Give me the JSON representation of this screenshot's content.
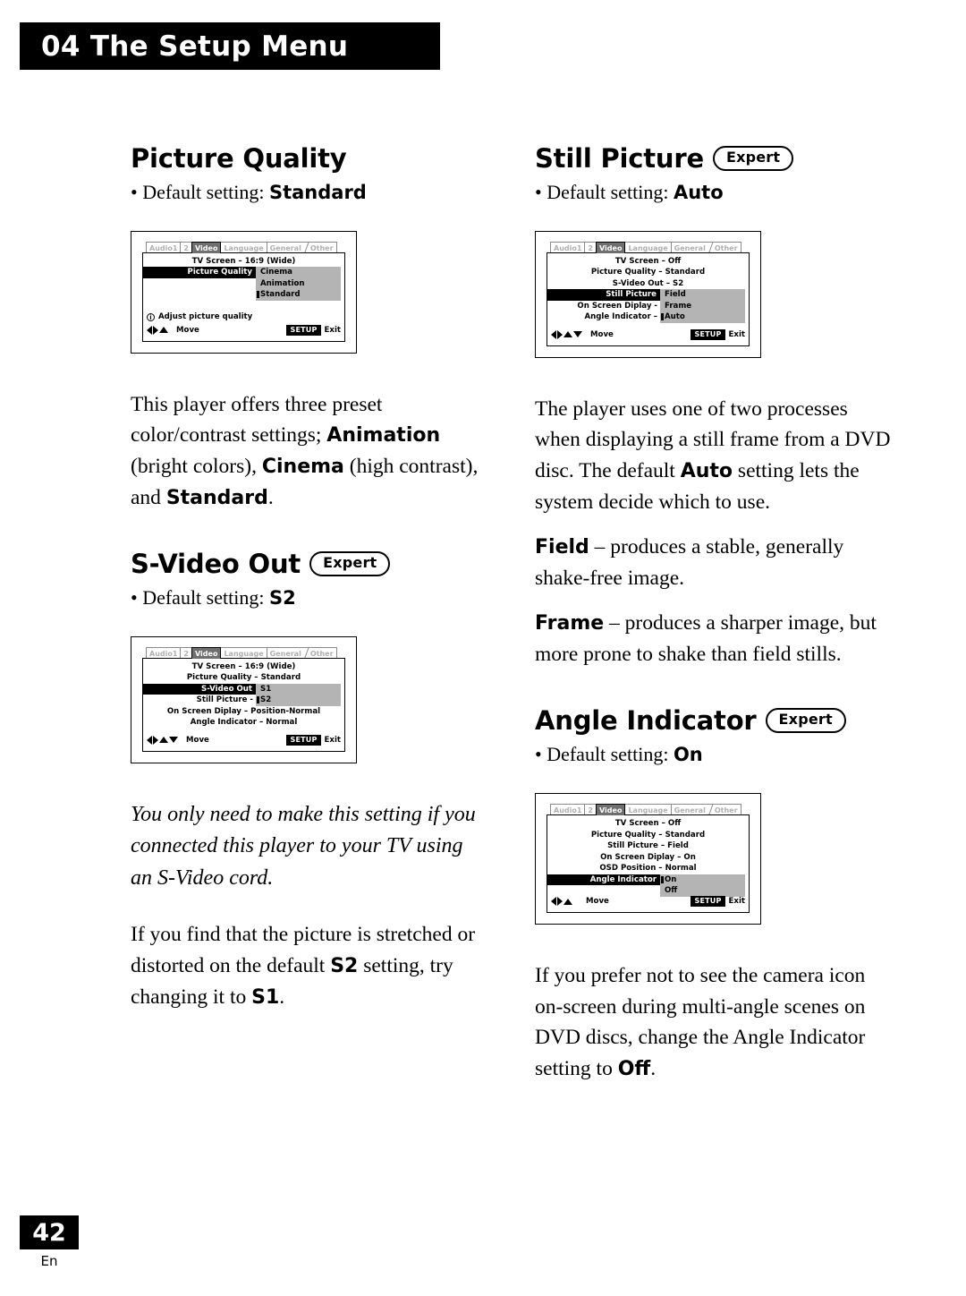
{
  "header": {
    "chapter_number": "04",
    "chapter_title": "The Setup Menu",
    "full": "04 The Setup Menu"
  },
  "footer": {
    "page_number": "42",
    "language_code": "En"
  },
  "labels": {
    "expert": "Expert",
    "move": "Move",
    "setup_key": "SETUP",
    "exit": "Exit",
    "info_glyph": "i"
  },
  "sections": {
    "picture_quality": {
      "title": "Picture Quality",
      "has_expert": false,
      "default_prefix": "• Default setting: ",
      "default_value": "Standard",
      "body": [
        {
          "t": "This player offers three preset color/contrast settings; "
        },
        {
          "t": "Animation",
          "b": true
        },
        {
          "t": " (bright colors), "
        },
        {
          "t": "Cinema",
          "b": true
        },
        {
          "t": " (high contrast), and "
        },
        {
          "t": "Standard",
          "b": true
        },
        {
          "t": "."
        }
      ]
    },
    "s_video_out": {
      "title": "S-Video Out",
      "has_expert": true,
      "default_prefix": "• Default setting: ",
      "default_value": "S2",
      "note": "You only need to make this setting if you connected this player to your TV using an S-Video cord.",
      "body": [
        {
          "t": "If you find that the picture is stretched or distorted on the default "
        },
        {
          "t": "S2",
          "b": true
        },
        {
          "t": " setting, try changing it to "
        },
        {
          "t": "S1",
          "b": true
        },
        {
          "t": "."
        }
      ]
    },
    "still_picture": {
      "title": "Still Picture",
      "has_expert": true,
      "default_prefix": "• Default setting: ",
      "default_value": "Auto",
      "body": [
        {
          "t": "The player uses one of two processes when displaying a still frame from a DVD disc. The default "
        },
        {
          "t": "Auto",
          "b": true
        },
        {
          "t": " setting lets the system decide which to use."
        }
      ],
      "body2": [
        {
          "t": "Field",
          "b": true
        },
        {
          "t": " – produces a stable, generally shake-free image."
        }
      ],
      "body3": [
        {
          "t": "Frame",
          "b": true
        },
        {
          "t": " – produces a sharper image, but more prone to shake than field stills."
        }
      ]
    },
    "angle_indicator": {
      "title": "Angle Indicator",
      "has_expert": true,
      "default_prefix": "• Default setting: ",
      "default_value": "On",
      "body": [
        {
          "t": "If you prefer not to see the camera icon on-screen during multi-angle scenes on DVD discs, change the Angle Indicator setting to "
        },
        {
          "t": "Off",
          "b": true
        },
        {
          "t": "."
        }
      ]
    }
  },
  "osd_tabs": [
    {
      "label": "Audio1",
      "active": false
    },
    {
      "label": "2",
      "active": false
    },
    {
      "label": "Video",
      "active": true
    },
    {
      "label": "Language",
      "active": false
    },
    {
      "label": "General",
      "active": false
    },
    {
      "label": "Other",
      "active": false,
      "slant": true
    }
  ],
  "osd": {
    "picture_quality": {
      "rows": [
        {
          "label": "TV Screen – 16:9 (Wide)",
          "center": true
        },
        {
          "label": "Picture Quality",
          "selected": true
        }
      ],
      "popup": {
        "options": [
          "Cinema",
          "Animation",
          "Standard"
        ],
        "current": "Standard"
      },
      "hint": "Adjust picture quality",
      "arrows": [
        "left",
        "right",
        "up"
      ]
    },
    "s_video_out": {
      "rows": [
        {
          "label": "TV Screen – 16:9 (Wide)",
          "center": true
        },
        {
          "label": "Picture Quality – Standard",
          "center": true
        },
        {
          "label": "S-Video Out",
          "selected": true
        },
        {
          "label": "Still Picture -",
          "value": ""
        },
        {
          "label": "On Screen Diplay – Position-Normal",
          "center": true
        },
        {
          "label": "Angle Indicator – Normal",
          "center": true
        }
      ],
      "popup": {
        "options": [
          "S1",
          "S2"
        ],
        "current": "S2"
      },
      "hint": null,
      "arrows": [
        "left",
        "right",
        "up",
        "down"
      ]
    },
    "still_picture": {
      "rows": [
        {
          "label": "TV Screen – Off",
          "center": true
        },
        {
          "label": "Picture Quality – Standard",
          "center": true
        },
        {
          "label": "S-Video Out – S2",
          "center": true
        },
        {
          "label": "Still Picture",
          "selected": true
        },
        {
          "label": "On Screen Diplay -",
          "value": ""
        },
        {
          "label": "Angle Indicator –",
          "value": ""
        }
      ],
      "popup": {
        "options": [
          "Field",
          "Frame",
          "Auto"
        ],
        "current": "Auto"
      },
      "hint": null,
      "arrows": [
        "left",
        "right",
        "up",
        "down"
      ]
    },
    "angle_indicator": {
      "rows": [
        {
          "label": "TV Screen – Off",
          "center": true
        },
        {
          "label": "Picture Quality – Standard",
          "center": true
        },
        {
          "label": "Still Picture – Field",
          "center": true
        },
        {
          "label": "On Screen Diplay – On",
          "center": true
        },
        {
          "label": "OSD Position – Normal",
          "center": true
        },
        {
          "label": "Angle Indicator",
          "selected": true
        }
      ],
      "popup": {
        "options": [
          "On",
          "Off"
        ],
        "current": "On"
      },
      "hint": null,
      "arrows": [
        "left",
        "right",
        "up"
      ]
    }
  }
}
